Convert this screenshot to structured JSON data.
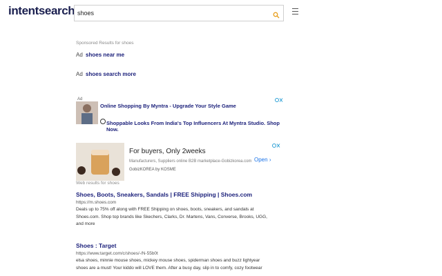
{
  "header": {
    "logo": "intentsearch",
    "search_value": "shoes"
  },
  "sponsored": {
    "label": "Sponsored Results for shoes",
    "items": [
      {
        "prefix": "Ad",
        "label": "shoes near me"
      },
      {
        "prefix": "Ad",
        "label": "shoes search more"
      }
    ]
  },
  "ad_banner": {
    "tag": "Ad",
    "title": "Online Shopping By Myntra - Upgrade Your Style Game",
    "subtitle": "Shoppable Looks From India's Top Influencers At Myntra Studio. Shop Now."
  },
  "ad_card": {
    "title": "For buyers, Only 2weeks",
    "description": "Manufacturers, Suppliers online B2B marketplace-Gobizkorea.com",
    "brand": "GobizKOREA by KOSME",
    "cta": "Open"
  },
  "web_results": {
    "label": "Web results for shoes",
    "items": [
      {
        "title": "Shoes, Boots, Sneakers, Sandals | FREE Shipping | Shoes.com",
        "url": "https://m.shoes.com",
        "desc_lines": [
          "Deals up to 75% off along with FREE Shipping on shoes, boots, sneakers, and sandals at",
          "Shoes.com. Shop top brands like Skechers, Clarks, Dr. Martens, Vans, Converse, Brooks, UGG,",
          "and more"
        ]
      },
      {
        "title": "Shoes : Target",
        "url": "https://www.target.com/c/shoes/-/N-55b0t",
        "desc_lines": [
          "elsa shoes, minnie mouse shoes, mickey mouse shoes, spiderman shoes and buzz lightyear",
          "shoes are a must! Your kiddo will LOVE them. After a busy day, slip in to comfy, cozy footwear"
        ]
      }
    ]
  }
}
